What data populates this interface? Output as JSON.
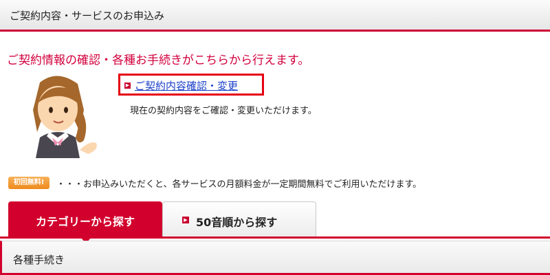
{
  "header": {
    "title": "ご契約内容・サービスのお申込み"
  },
  "main": {
    "headline": "ご契約情報の確認・各種お手続きがこちらから行えます。",
    "contract_link": {
      "label": "ご契約内容確認・変更",
      "description": "現在の契約内容をご確認・変更いただけます。"
    },
    "promo": {
      "badge": "初回無料!",
      "note": "・・・お申込みいただくと、各サービスの月額料金が一定期間無料でご利用いただけます。"
    }
  },
  "tabs": [
    {
      "label": "カテゴリーから探す",
      "active": true
    },
    {
      "label": "50音順から探す",
      "active": false
    }
  ],
  "section": {
    "title": "各種手続き"
  },
  "icons": {
    "link_arrow": "arrow-right-icon",
    "tab_arrow": "arrow-right-icon",
    "mascot": "mascot-illustration"
  },
  "colors": {
    "accent": "#d2002d",
    "link": "#1a3fc8",
    "highlight_border": "#e60012",
    "badge": "#ee8a1c"
  }
}
